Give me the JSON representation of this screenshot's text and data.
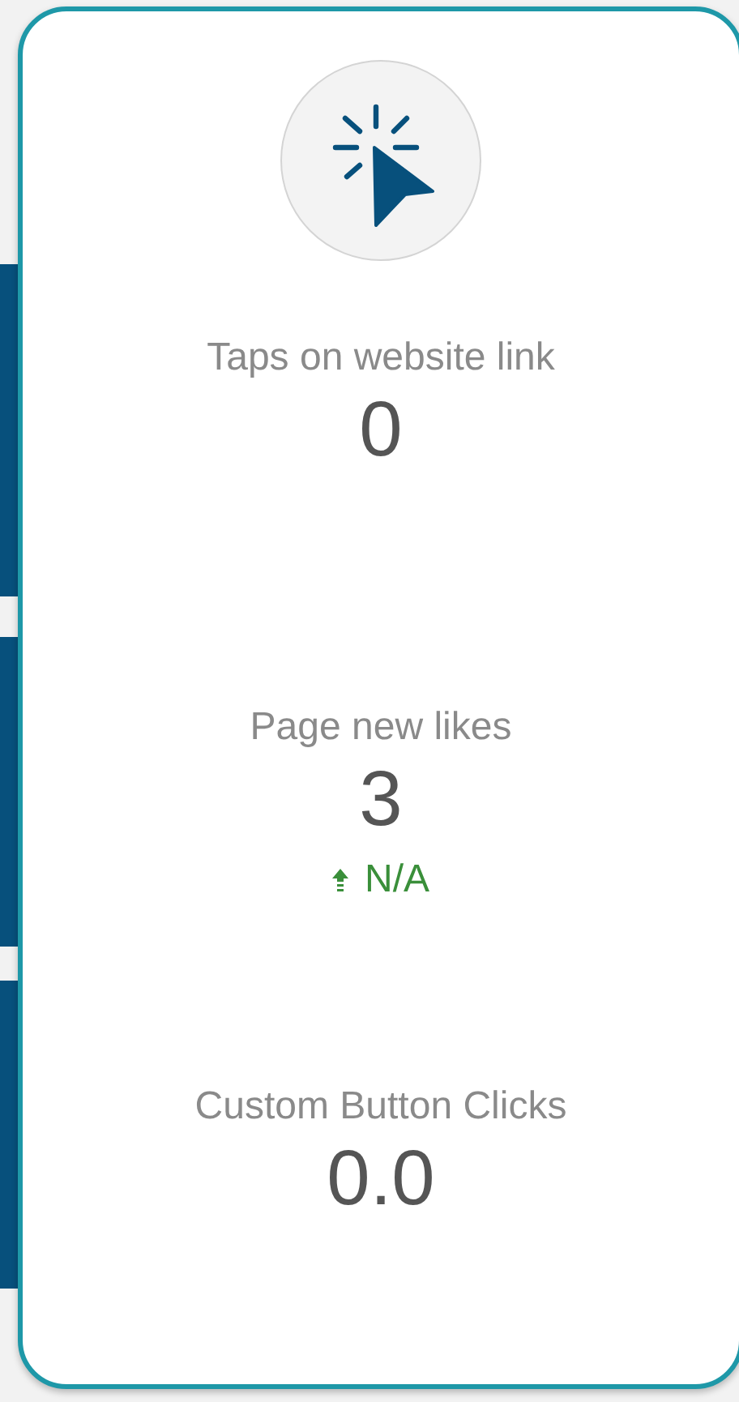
{
  "stats": [
    {
      "label": "Taps on website link",
      "value": "0"
    },
    {
      "label": "Page new likes",
      "value": "3",
      "trend": {
        "rising": true,
        "text": "N/A"
      }
    },
    {
      "label": "Custom Button Clicks",
      "value": "0.0"
    }
  ]
}
